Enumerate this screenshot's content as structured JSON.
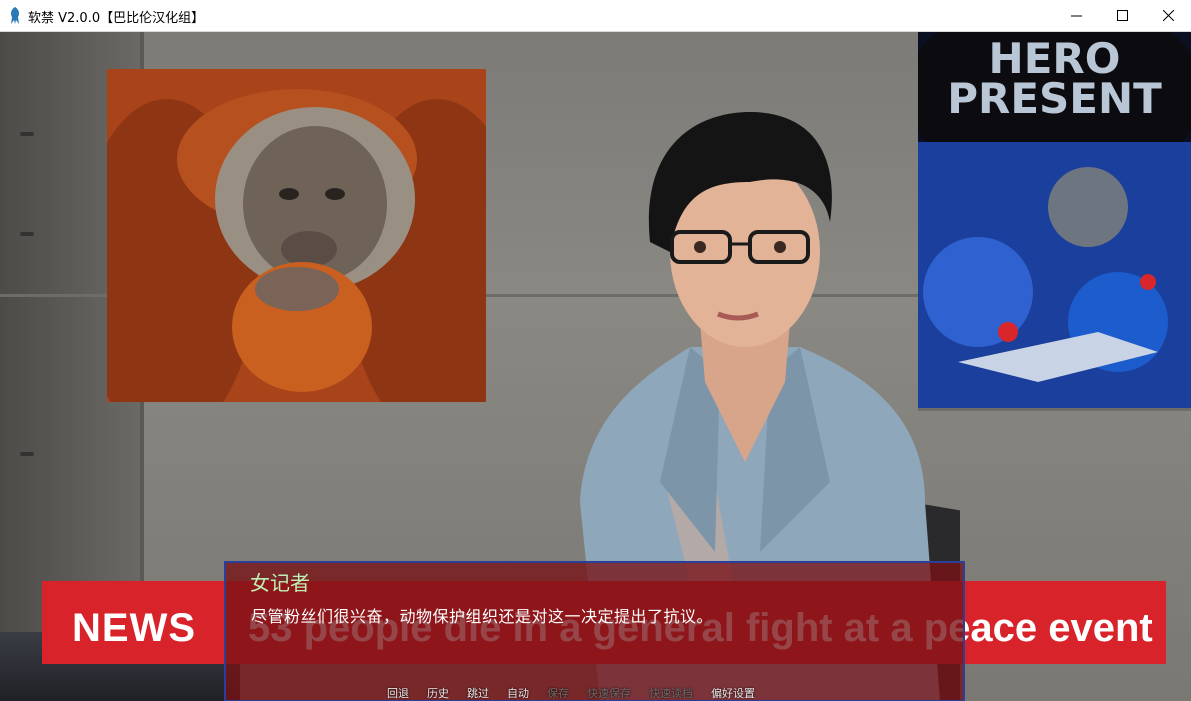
{
  "window": {
    "title": "软禁 V2.0.0【巴比伦汉化组】",
    "icon": "squid-app-icon",
    "controls": [
      "minimize-icon",
      "maximize-icon",
      "close-icon"
    ]
  },
  "poster": {
    "text_line1": "HERO",
    "text_line2": "PRESENT"
  },
  "news_banner": {
    "label": "NEWS",
    "headline": "53 people die in a general fight at a peace event",
    "color": "#d8232a"
  },
  "dialogue": {
    "speaker": "女记者",
    "text": "尽管粉丝们很兴奋，动物保护组织还是对这一决定提出了抗议。",
    "speaker_color": "#bff0b4"
  },
  "quick_menu": {
    "items": [
      {
        "label": "回退",
        "dim": false
      },
      {
        "label": "历史",
        "dim": false
      },
      {
        "label": "跳过",
        "dim": false
      },
      {
        "label": "自动",
        "dim": false
      },
      {
        "label": "保存",
        "dim": true
      },
      {
        "label": "快速保存",
        "dim": true
      },
      {
        "label": "快速读档",
        "dim": true
      },
      {
        "label": "偏好设置",
        "dim": false
      }
    ]
  }
}
